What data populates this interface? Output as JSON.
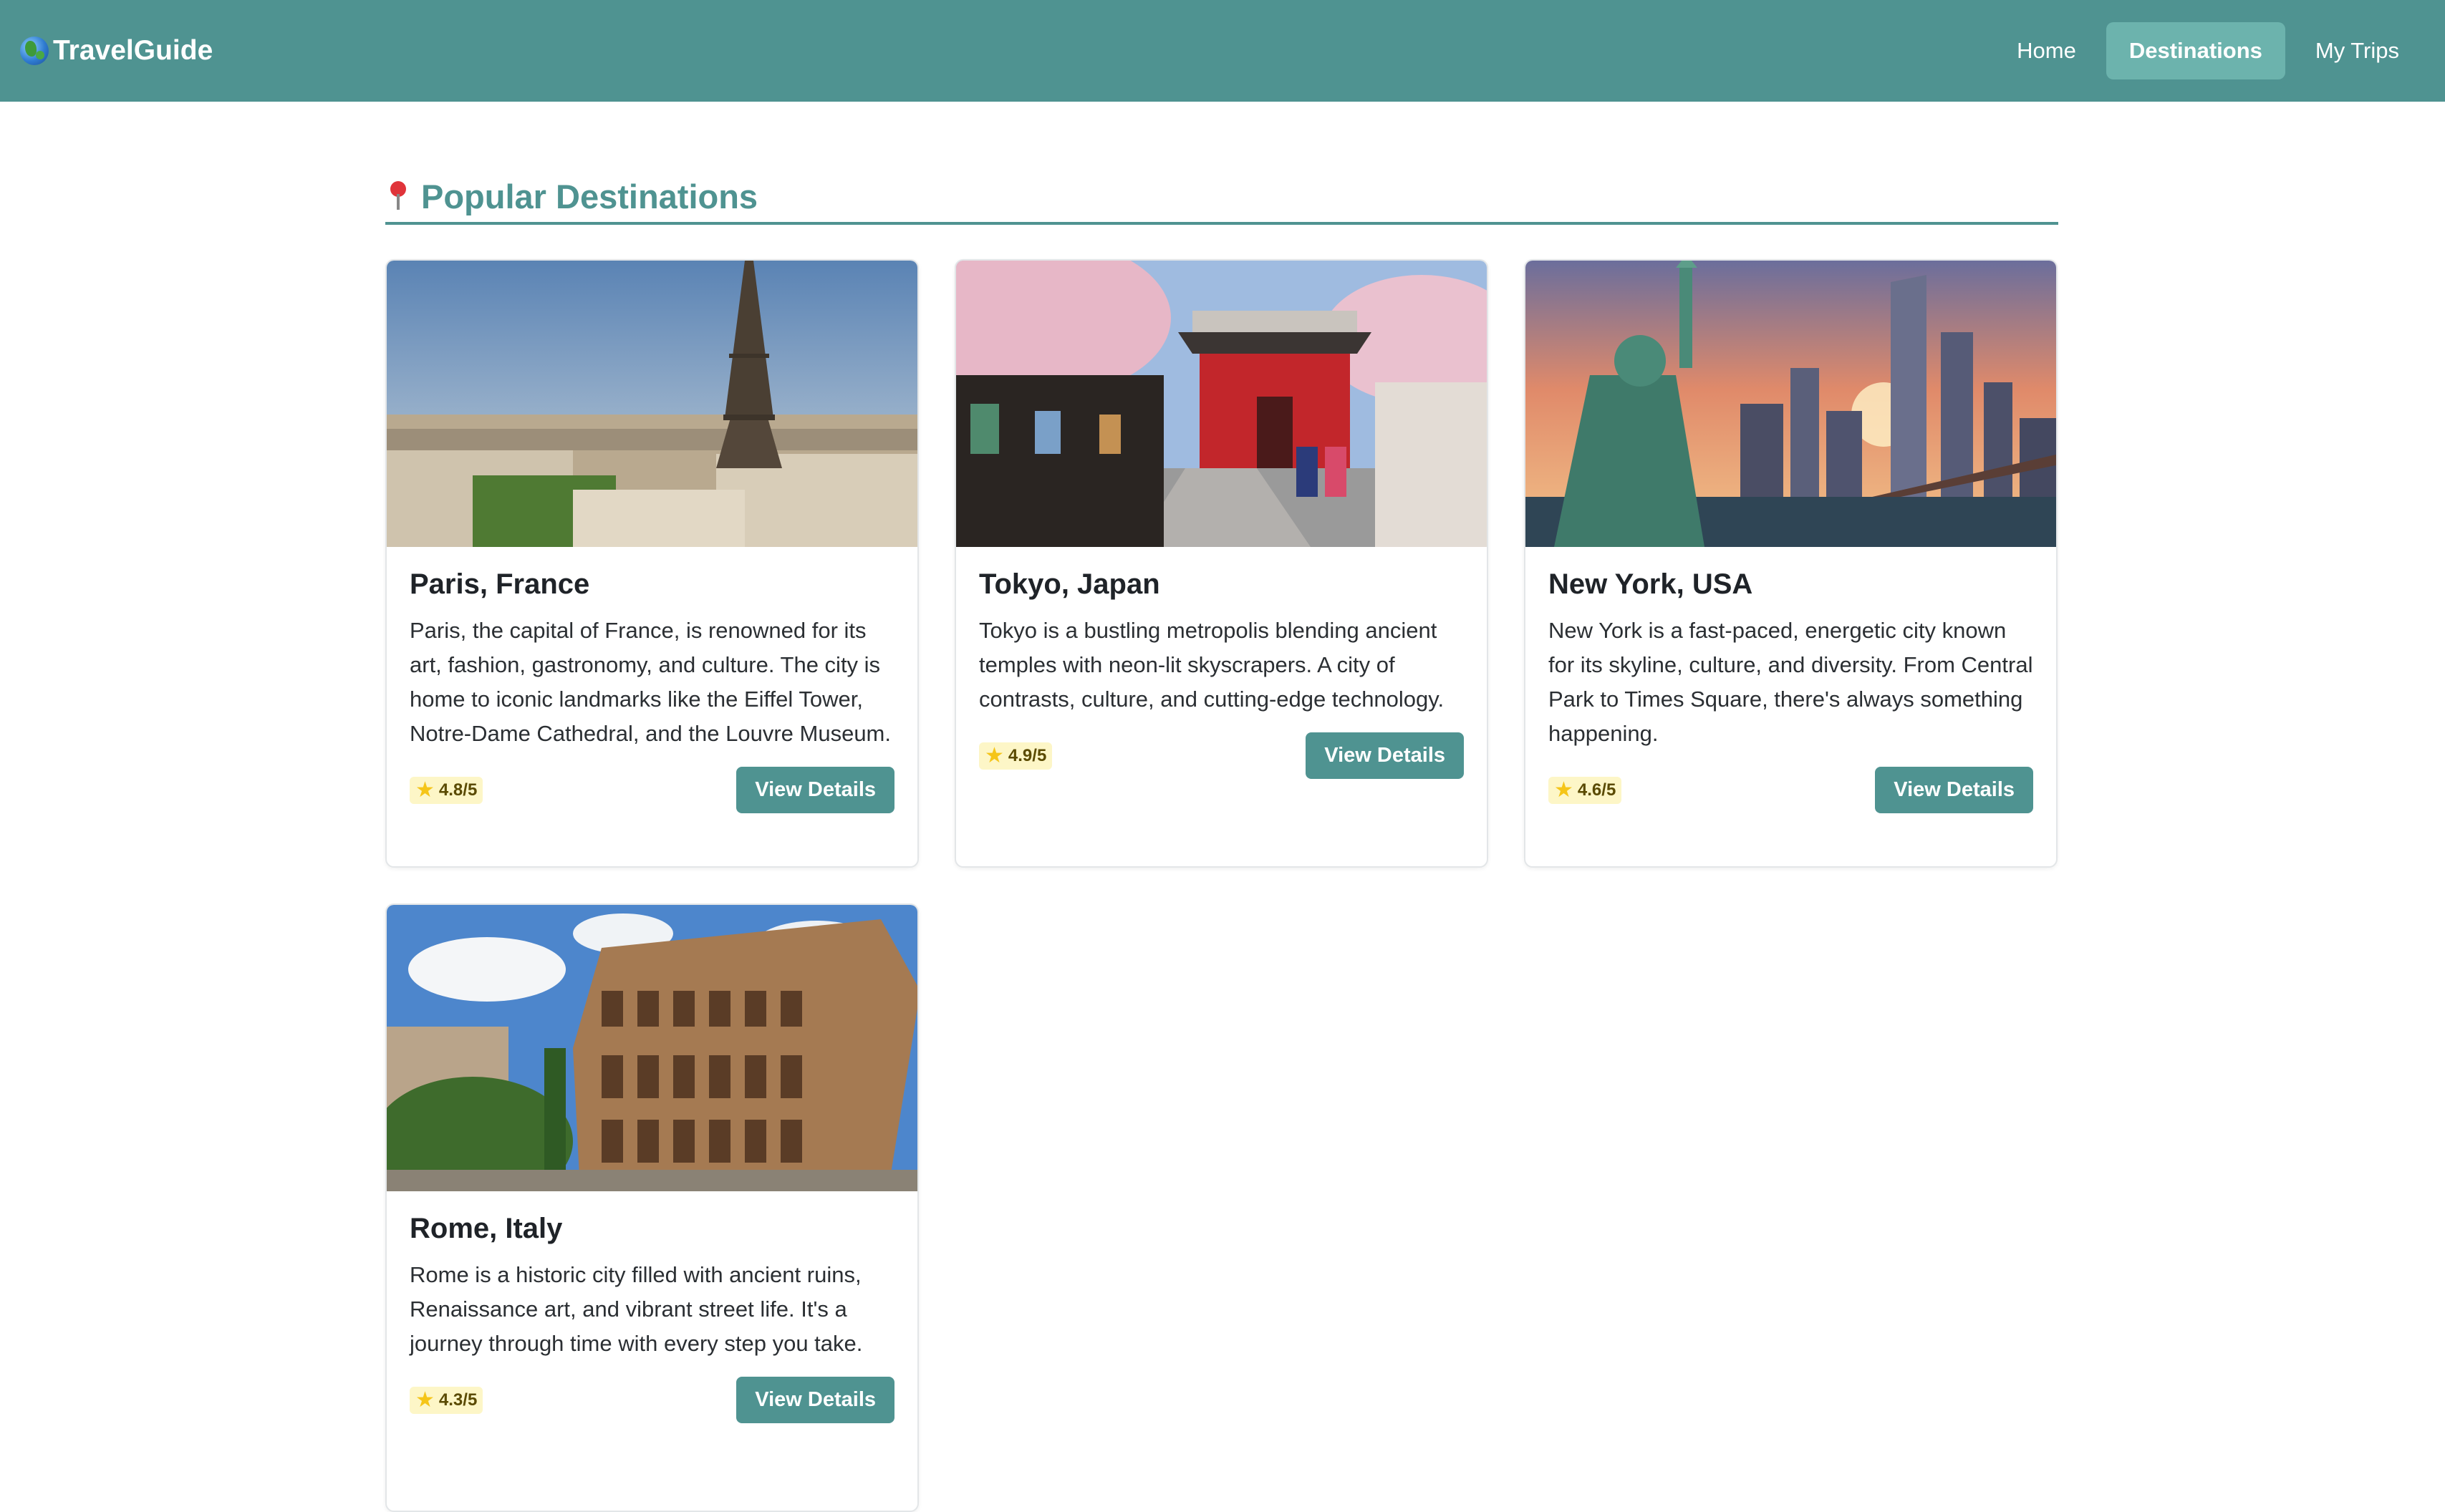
{
  "header": {
    "brand": "TravelGuide",
    "nav": [
      {
        "label": "Home",
        "active": false
      },
      {
        "label": "Destinations",
        "active": true
      },
      {
        "label": "My Trips",
        "active": false
      }
    ]
  },
  "section": {
    "title": "Popular Destinations",
    "icon": "map-pin-icon"
  },
  "destinations": [
    {
      "name": "Paris, France",
      "description": "Paris, the capital of France, is renowned for its art, fashion, gastronomy, and culture. The city is home to iconic landmarks like the Eiffel Tower, Notre-Dame Cathedral, and the Louvre Museum.",
      "rating": "4.8/5",
      "button": "View Details",
      "image": "eiffel-tower-photo"
    },
    {
      "name": "Tokyo, Japan",
      "description": "Tokyo is a bustling metropolis blending ancient temples with neon-lit skyscrapers. A city of contrasts, culture, and cutting-edge technology.",
      "rating": "4.9/5",
      "button": "View Details",
      "image": "tokyo-temple-photo"
    },
    {
      "name": "New York, USA",
      "description": "New York is a fast-paced, energetic city known for its skyline, culture, and diversity. From Central Park to Times Square, there's always something happening.",
      "rating": "4.6/5",
      "button": "View Details",
      "image": "statue-of-liberty-photo"
    },
    {
      "name": "Rome, Italy",
      "description": "Rome is a historic city filled with ancient ruins, Renaissance art, and vibrant street life. It's a journey through time with every step you take.",
      "rating": "4.3/5",
      "button": "View Details",
      "image": "colosseum-photo"
    }
  ],
  "colors": {
    "primary": "#4f9391",
    "nav_active": "#6cb3ad",
    "rating_bg": "#fdf6c7"
  }
}
